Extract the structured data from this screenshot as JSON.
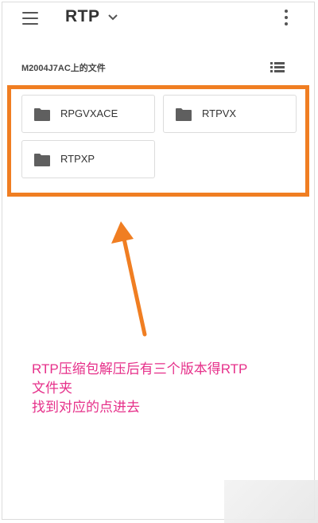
{
  "appbar": {
    "title": "RTP",
    "menu_icon": "hamburger-menu-icon",
    "dropdown_icon": "chevron-down-icon",
    "more_icon": "more-vertical-icon"
  },
  "subheader": {
    "location_label": "M2004J7AC上的文件",
    "view_toggle_icon": "list-view-icon"
  },
  "folders": [
    {
      "name": "RPGVXACE",
      "icon": "folder-icon"
    },
    {
      "name": "RTPVX",
      "icon": "folder-icon"
    },
    {
      "name": "RTPXP",
      "icon": "folder-icon"
    }
  ],
  "annotation": {
    "line1": "RTP压缩包解压后有三个版本得RTP",
    "line2": "文件夹",
    "line3": "找到对应的点进去"
  },
  "colors": {
    "highlight": "#f07e22",
    "annotation_text": "#e6308a",
    "icon": "#555555"
  }
}
